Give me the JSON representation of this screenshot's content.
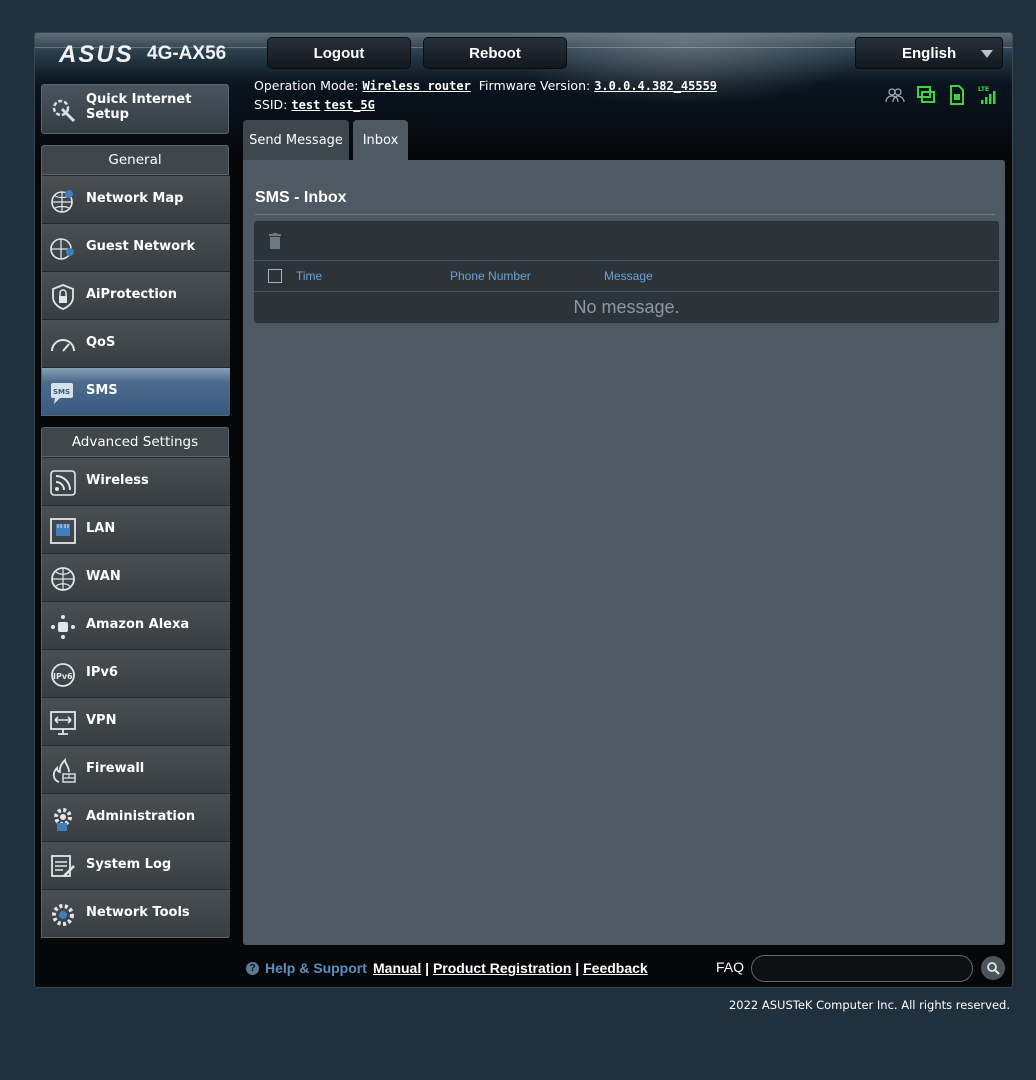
{
  "header": {
    "brand": "ASUS",
    "model": "4G-AX56",
    "logout_label": "Logout",
    "reboot_label": "Reboot",
    "language": "English",
    "operation_mode_label": "Operation Mode:",
    "operation_mode_value": "Wireless router",
    "firmware_label": "Firmware Version:",
    "firmware_value": "3.0.0.4.382_45559",
    "ssid_label": "SSID:",
    "ssid_2g": "test",
    "ssid_5g": "test_5G",
    "status_icons": [
      "clients-icon",
      "usb-icon",
      "sim-icon",
      "lte-signal-icon"
    ]
  },
  "sidebar": {
    "quick_setup": "Quick Internet Setup",
    "general_title": "General",
    "general_items": [
      {
        "label": "Network Map",
        "icon": "globe-pin-icon"
      },
      {
        "label": "Guest Network",
        "icon": "globe-users-icon"
      },
      {
        "label": "AiProtection",
        "icon": "shield-lock-icon"
      },
      {
        "label": "QoS",
        "icon": "speedometer-icon"
      },
      {
        "label": "SMS",
        "icon": "sms-icon",
        "active": true
      }
    ],
    "advanced_title": "Advanced Settings",
    "advanced_items": [
      {
        "label": "Wireless",
        "icon": "wifi-icon"
      },
      {
        "label": "LAN",
        "icon": "lan-icon"
      },
      {
        "label": "WAN",
        "icon": "globe-icon"
      },
      {
        "label": "Amazon Alexa",
        "icon": "alexa-icon"
      },
      {
        "label": "IPv6",
        "icon": "ipv6-icon"
      },
      {
        "label": "VPN",
        "icon": "vpn-icon"
      },
      {
        "label": "Firewall",
        "icon": "firewall-icon"
      },
      {
        "label": "Administration",
        "icon": "gear-icon"
      },
      {
        "label": "System Log",
        "icon": "log-icon"
      },
      {
        "label": "Network Tools",
        "icon": "tools-icon"
      }
    ]
  },
  "tabs": [
    {
      "label": "Send Message",
      "active": false
    },
    {
      "label": "Inbox",
      "active": true
    }
  ],
  "main": {
    "title": "SMS - Inbox",
    "columns": [
      "Time",
      "Phone Number",
      "Message"
    ],
    "empty_text": "No message."
  },
  "footer": {
    "help_label": "Help & Support",
    "manual": "Manual",
    "product_registration": "Product Registration",
    "feedback": "Feedback",
    "faq_label": "FAQ",
    "faq_value": "",
    "copyright": "2022 ASUSTeK Computer Inc. All rights reserved."
  },
  "colors": {
    "accent_blue": "#6fa0d1",
    "active_nav": "#375a80",
    "status_green": "#3fd43f"
  }
}
